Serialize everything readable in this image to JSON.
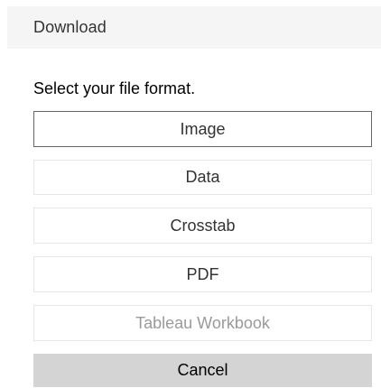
{
  "header": {
    "title": "Download"
  },
  "prompt": "Select your file format.",
  "formats": [
    {
      "label": "Image",
      "state": "selected"
    },
    {
      "label": "Data",
      "state": "enabled"
    },
    {
      "label": "Crosstab",
      "state": "enabled"
    },
    {
      "label": "PDF",
      "state": "enabled"
    },
    {
      "label": "Tableau Workbook",
      "state": "disabled"
    }
  ],
  "cancel_label": "Cancel"
}
